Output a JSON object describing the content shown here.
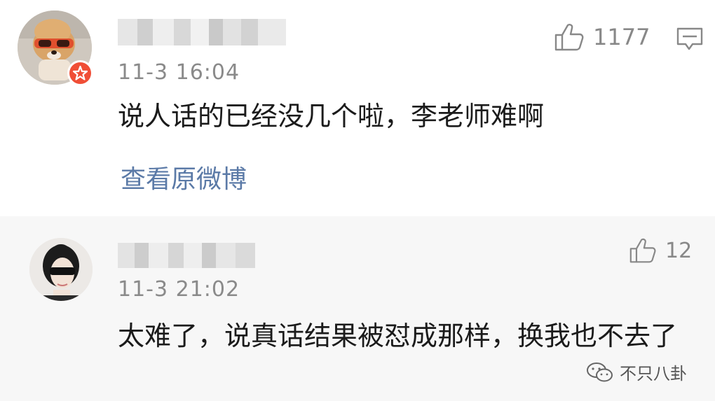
{
  "comments": [
    {
      "time": "11-3 16:04",
      "text": "说人话的已经没几个啦，李老师难啊",
      "likes": "1177",
      "view_link": "查看原微博",
      "avatar_icon": "dog-sunglasses-avatar",
      "badge_icon": "verified-star-badge"
    },
    {
      "time": "11-3 21:02",
      "text": "太难了，说真话结果被怼成那样，换我也不去了",
      "likes": "12",
      "avatar_icon": "woman-sunglasses-avatar"
    }
  ],
  "watermark": {
    "text": "不只八卦",
    "icon": "wechat-icon"
  },
  "colors": {
    "link": "#5b7aa7",
    "meta": "#8a8a8a",
    "badge": "#f04e36",
    "card2_bg": "#f7f7f7"
  }
}
